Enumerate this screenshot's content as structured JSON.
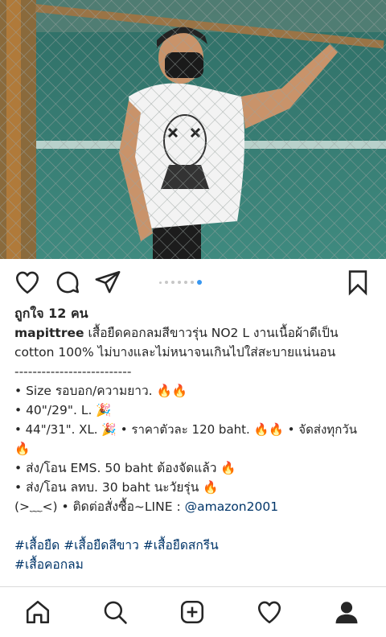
{
  "post": {
    "likes_text": "ถูกใจ 12 คน",
    "username": "mapittree",
    "caption_lines": [
      " เสื้อยืดคอกลมสีขาวรุ่น NO2 L งานเนื้อผ้าดีเป็น",
      "cotton 100% ไม่บางและไม่หนาจนเกินไปใส่สะบายแน่นอน",
      "--------------------------",
      "• Size รอบอก/ความยาว. 🔥🔥",
      "• 40\"/29\". L. 🎉",
      "• 44\"/31\". XL. 🎉 • ราคาตัวละ 120 baht. 🔥🔥 • จัดส่งทุกวัน",
      "🔥",
      "• ส่ง/โอน EMS. 50 baht ต้องจัดแล้ว 🔥",
      "• ส่ง/โอน ลทบ. 30 baht นะวัยรุ่น 🔥"
    ],
    "contact_prefix": "(>﹏<) • ติดต่อสั่งซื้อ~LINE : ",
    "contact_link": "@amazon2001",
    "hashtags_line1": "#เสื้อยืด #เสื้อยืดสีขาว #เสื้อยืดสกรีน",
    "hashtags_line2": "#เสื้อคอกลม"
  },
  "carousel": {
    "count": 7,
    "active_index": 6
  },
  "icons": {
    "like": "heart-icon",
    "comment": "comment-icon",
    "share": "paper-plane-icon",
    "save": "bookmark-icon",
    "nav": [
      "home-icon",
      "search-icon",
      "add-post-icon",
      "activity-heart-icon",
      "profile-icon"
    ]
  },
  "colors": {
    "link": "#003569",
    "active_dot": "#3897f0",
    "text": "#262626"
  }
}
